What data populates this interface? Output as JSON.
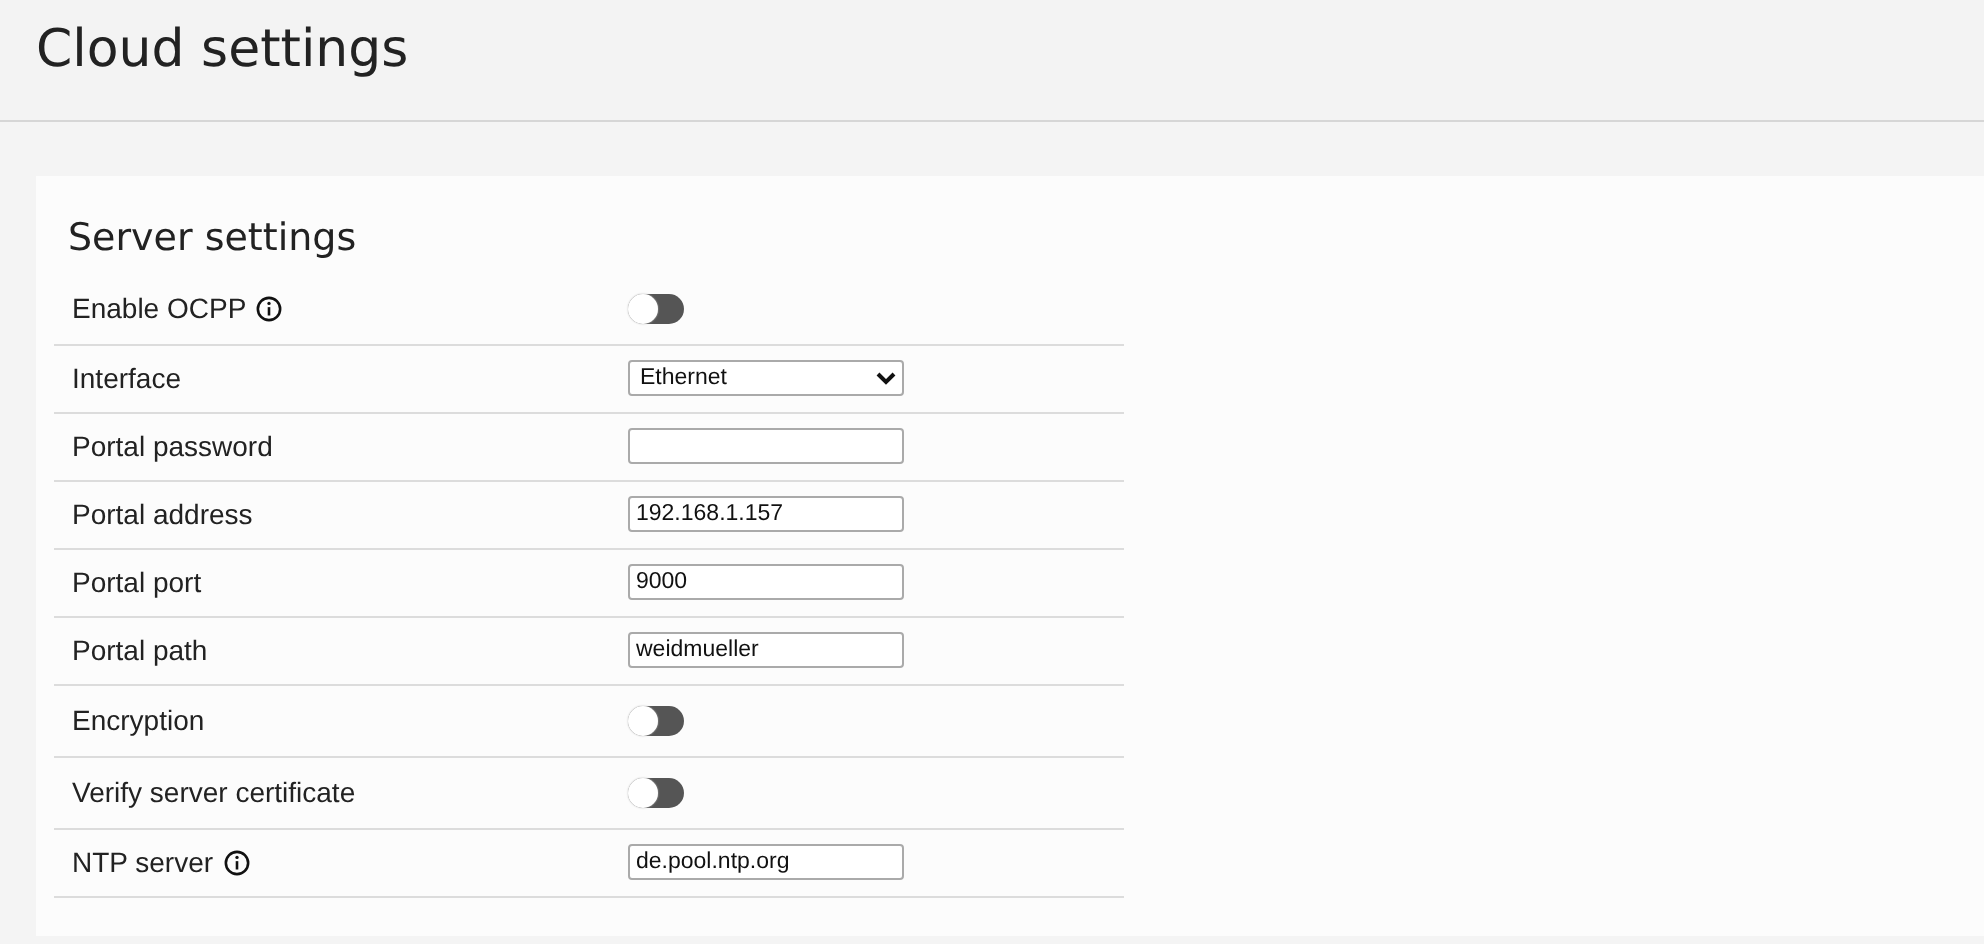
{
  "page": {
    "title": "Cloud settings"
  },
  "section": {
    "title": "Server settings"
  },
  "rows": [
    {
      "label": "Enable OCPP",
      "info": true,
      "kind": "toggle",
      "on": false
    },
    {
      "label": "Interface",
      "info": false,
      "kind": "select",
      "value": "Ethernet"
    },
    {
      "label": "Portal password",
      "info": false,
      "kind": "input"
    },
    {
      "label": "Portal address",
      "info": false,
      "kind": "input",
      "value": "192.168.1.157"
    },
    {
      "label": "Portal port",
      "info": false,
      "kind": "input",
      "value": "9000"
    },
    {
      "label": "Portal path",
      "info": false,
      "kind": "input",
      "value": "weidmueller"
    },
    {
      "label": "Encryption",
      "info": false,
      "kind": "toggle",
      "on": false
    },
    {
      "label": "Verify server certificate",
      "info": false,
      "kind": "toggle",
      "on": false
    },
    {
      "label": "NTP server",
      "info": true,
      "kind": "input",
      "value": "de.pool.ntp.org"
    }
  ]
}
